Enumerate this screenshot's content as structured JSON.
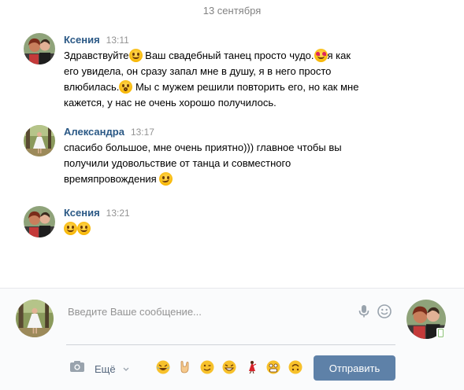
{
  "date_separator": "13 сентября",
  "messages": [
    {
      "author": "Ксения",
      "time": "13:11",
      "avatar_icon": "couple-photo-avatar",
      "lines": [
        "Здравствуйте",
        " Ваш свадебный танец просто чудо.",
        "я как",
        "его увидела, он сразу запал мне в душу, я в него просто",
        "влюбилась.",
        " Мы с мужем решили повторить его, но как мне",
        "кажется, у нас не очень хорошо получилось."
      ]
    },
    {
      "author": "Александра",
      "time": "13:17",
      "avatar_icon": "bride-photo-avatar",
      "lines": [
        "спасибо большое, мне очень приятно))) главное чтобы вы",
        "получили удовольствие от танца и совместного",
        "времяпровождения"
      ]
    },
    {
      "author": "Ксения",
      "time": "13:21",
      "avatar_icon": "couple-photo-avatar"
    }
  ],
  "composer": {
    "placeholder": "Введите Ваше сообщение...",
    "value": "",
    "more_label": "Ещё",
    "send_label": "Отправить",
    "quick_emojis": [
      "laughing-tears",
      "rock-hand",
      "winking",
      "grinning",
      "dancer",
      "scared",
      "upside-down"
    ]
  },
  "colors": {
    "author": "#2a5885",
    "time": "#939393",
    "send_button": "#5e81a8",
    "date": "#828282"
  }
}
